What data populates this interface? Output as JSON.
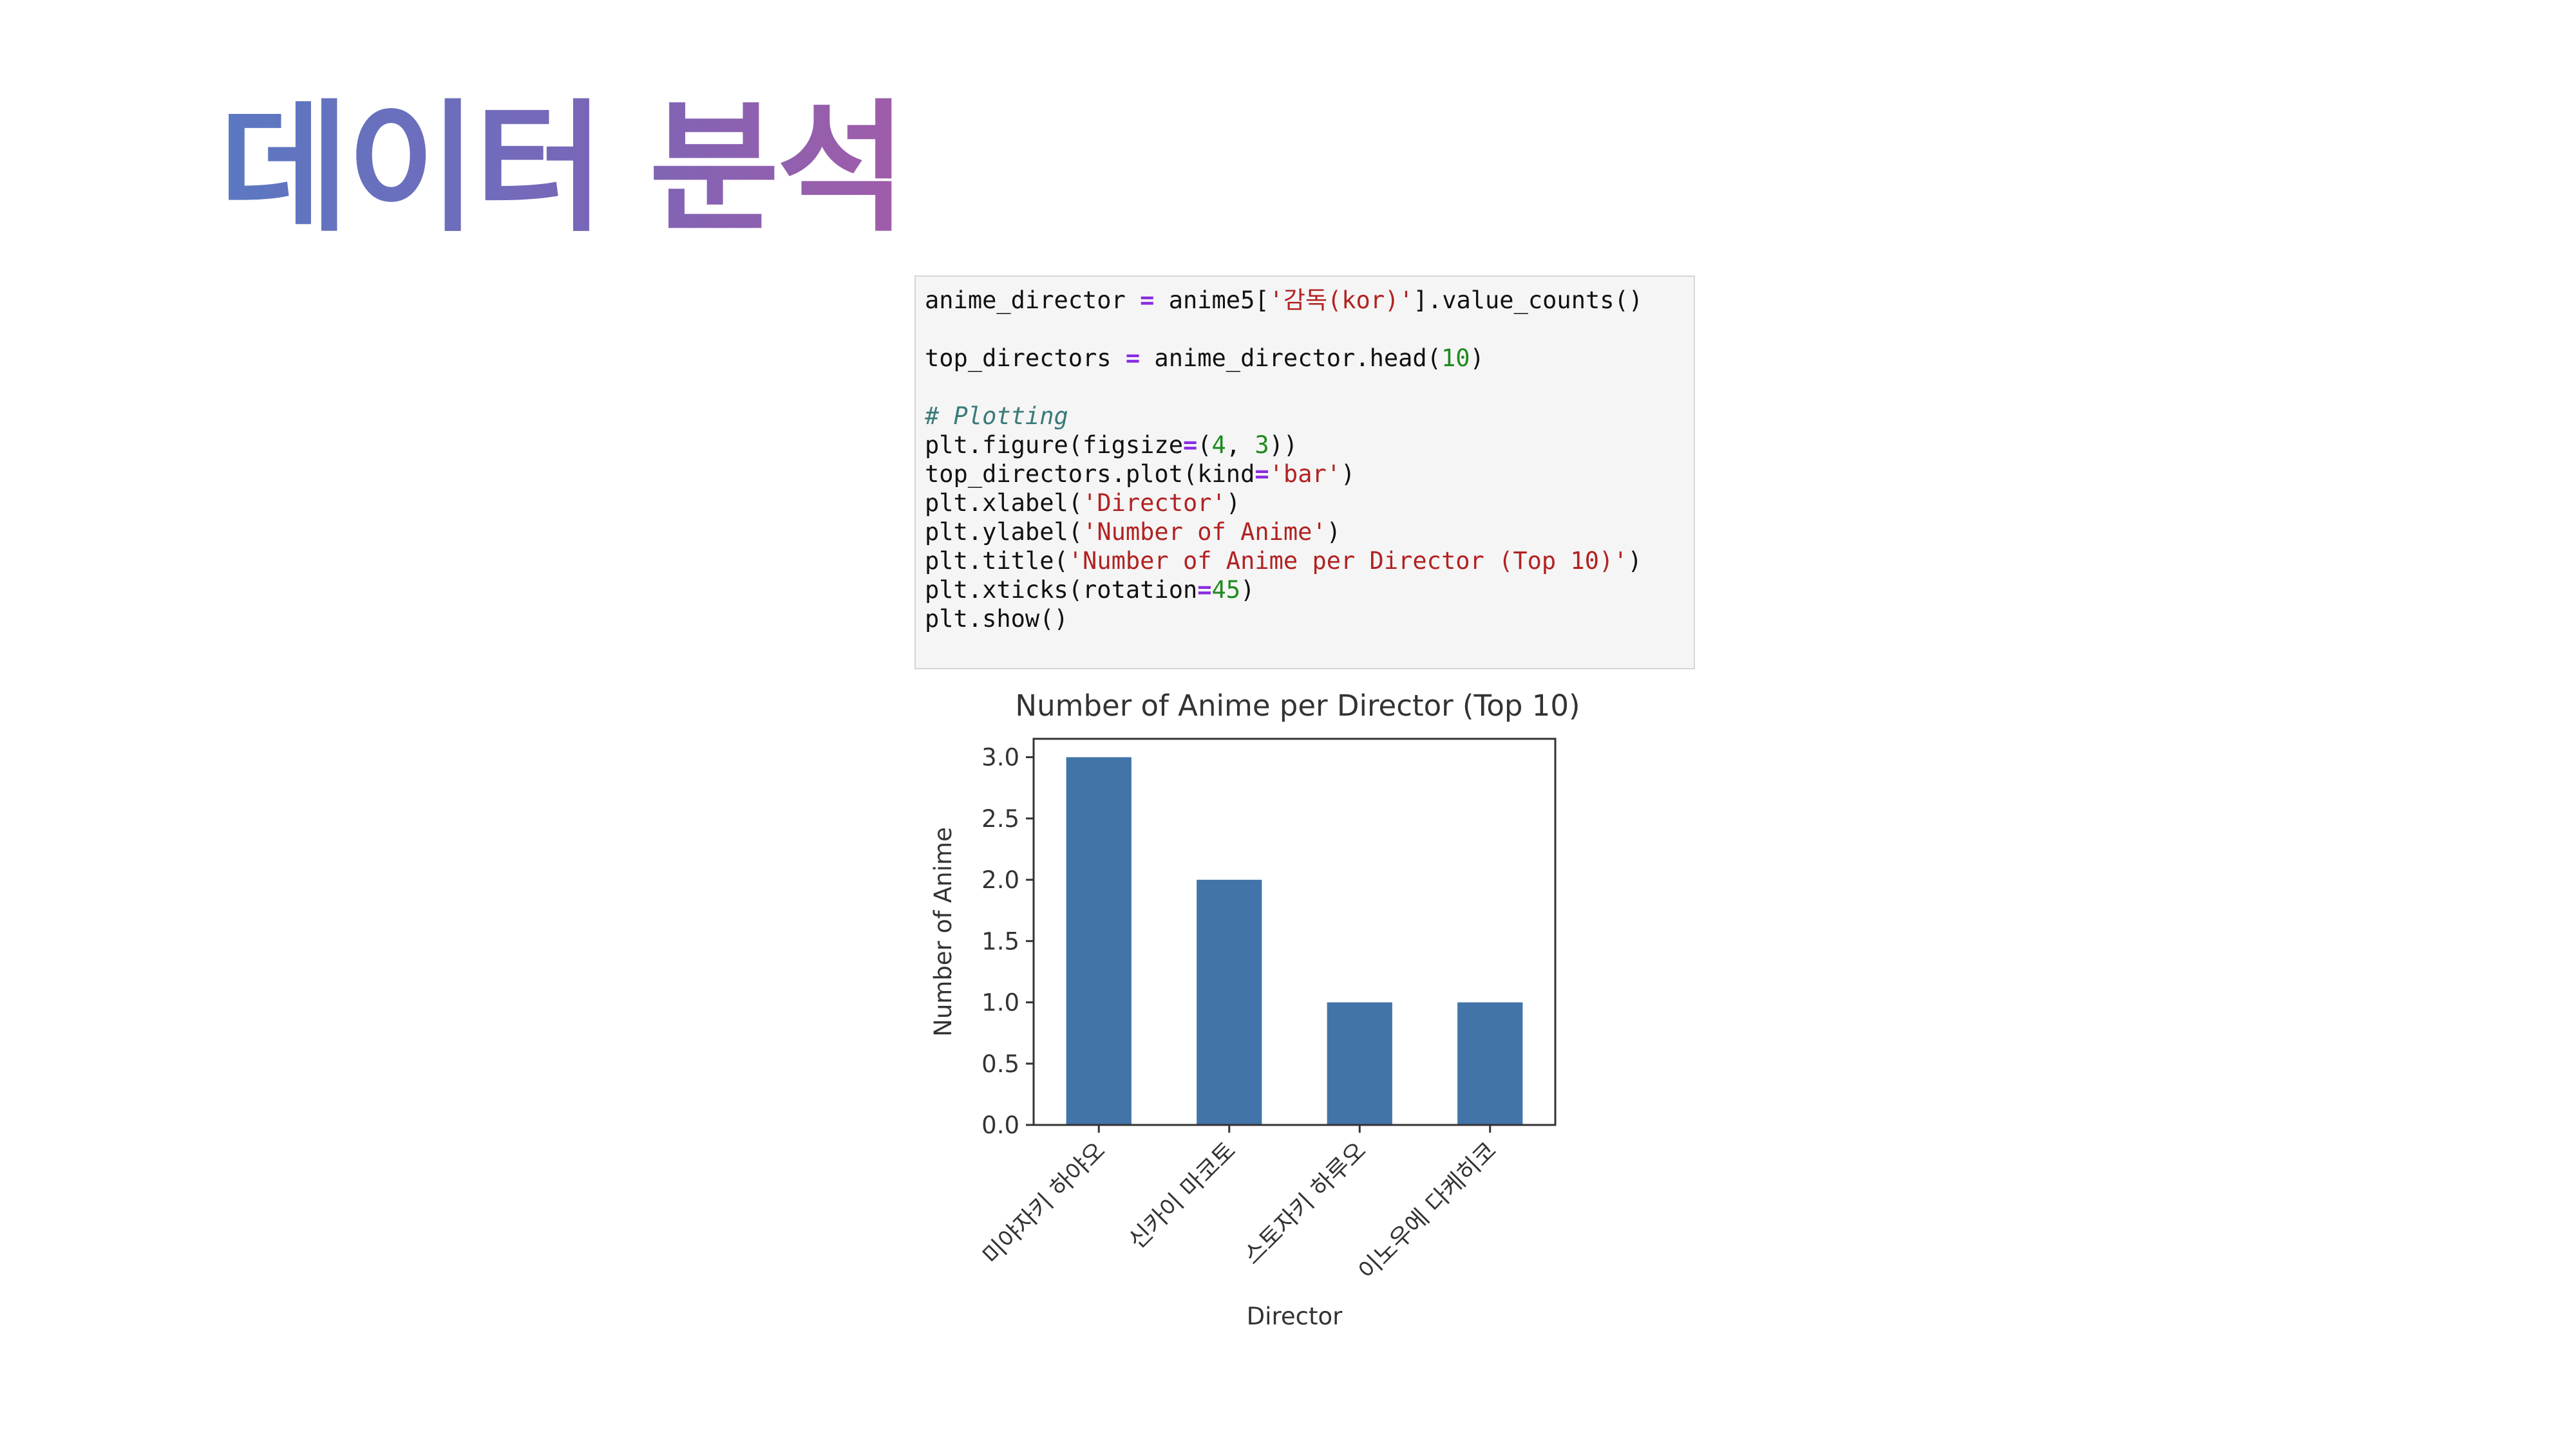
{
  "slide": {
    "title": "데이터 분석"
  },
  "code_cell": {
    "lines": [
      [
        {
          "t": "anime_director "
        },
        {
          "t": "=",
          "c": "op"
        },
        {
          "t": " anime5["
        },
        {
          "t": "'감독(kor)'",
          "c": "str"
        },
        {
          "t": "].value_counts()"
        }
      ],
      [],
      [
        {
          "t": "top_directors "
        },
        {
          "t": "=",
          "c": "op"
        },
        {
          "t": " anime_director.head("
        },
        {
          "t": "10",
          "c": "num"
        },
        {
          "t": ")"
        }
      ],
      [],
      [
        {
          "t": "# Plotting",
          "c": "com"
        }
      ],
      [
        {
          "t": "plt.figure(figsize"
        },
        {
          "t": "=",
          "c": "op"
        },
        {
          "t": "("
        },
        {
          "t": "4",
          "c": "num"
        },
        {
          "t": ", "
        },
        {
          "t": "3",
          "c": "num"
        },
        {
          "t": "))"
        }
      ],
      [
        {
          "t": "top_directors.plot(kind"
        },
        {
          "t": "=",
          "c": "op"
        },
        {
          "t": "'bar'",
          "c": "str"
        },
        {
          "t": ")"
        }
      ],
      [
        {
          "t": "plt.xlabel("
        },
        {
          "t": "'Director'",
          "c": "str"
        },
        {
          "t": ")"
        }
      ],
      [
        {
          "t": "plt.ylabel("
        },
        {
          "t": "'Number of Anime'",
          "c": "str"
        },
        {
          "t": ")"
        }
      ],
      [
        {
          "t": "plt.title("
        },
        {
          "t": "'Number of Anime per Director (Top 10)'",
          "c": "str"
        },
        {
          "t": ")"
        }
      ],
      [
        {
          "t": "plt.xticks(rotation"
        },
        {
          "t": "=",
          "c": "op"
        },
        {
          "t": "45",
          "c": "num"
        },
        {
          "t": ")"
        }
      ],
      [
        {
          "t": "plt.show()"
        }
      ]
    ]
  },
  "colors": {
    "bar": "#4374a9",
    "axis": "#333333"
  },
  "chart_data": {
    "type": "bar",
    "title": "Number of Anime per Director (Top 10)",
    "xlabel": "Director",
    "ylabel": "Number of Anime",
    "categories": [
      "미야자키 하야오",
      "신카이 마코토",
      "스토자키 하루오",
      "이노우에 다케히코"
    ],
    "values": [
      3,
      2,
      1,
      1
    ],
    "ylim": [
      0,
      3.15
    ],
    "yticks": [
      "0.0",
      "0.5",
      "1.0",
      "1.5",
      "2.0",
      "2.5",
      "3.0"
    ],
    "ytick_values": [
      0,
      0.5,
      1,
      1.5,
      2,
      2.5,
      3
    ],
    "xtick_rotation": 45,
    "grid": false,
    "legend": "none"
  }
}
